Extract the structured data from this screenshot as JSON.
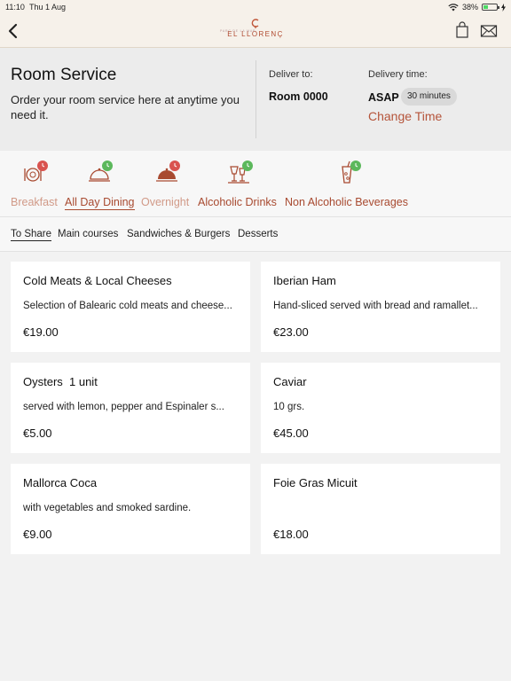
{
  "status_bar": {
    "time": "11:10",
    "date": "Thu 1 Aug",
    "battery": "38%",
    "battery_level": 0.38
  },
  "nav": {
    "logo_name": "EL LLORENÇ",
    "logo_sub": "PARC DE LA MAR",
    "icons": [
      "chevron-left-icon",
      "shopping-bag-icon",
      "envelope-icon"
    ]
  },
  "header": {
    "title": "Room Service",
    "description": "Order your room service here at anytime you need it.",
    "deliver_label": "Deliver to:",
    "room": "Room 0000",
    "delivery_time_label": "Delivery time:",
    "asap": "ASAP",
    "minutes": "30 minutes",
    "change_time": "Change Time"
  },
  "categories": [
    {
      "label": "Breakfast",
      "status": "closed",
      "state": "dim"
    },
    {
      "label": "All Day Dining",
      "status": "open",
      "state": "active"
    },
    {
      "label": "Overnight",
      "status": "closed",
      "state": "dim"
    },
    {
      "label": "Alcoholic Drinks",
      "status": "open",
      "state": "normal"
    },
    {
      "label": "Non Alcoholic Beverages",
      "status": "open",
      "state": "normal"
    }
  ],
  "status_colors": {
    "open": "#5cb85c",
    "closed": "#d9534f",
    "accent": "#a84a30"
  },
  "subcategories": [
    {
      "label": "To Share",
      "active": true
    },
    {
      "label": "Main courses",
      "active": false
    },
    {
      "label": "Sandwiches & Burgers",
      "active": false
    },
    {
      "label": "Desserts",
      "active": false
    }
  ],
  "items": [
    {
      "name": "Cold Meats & Local Cheeses",
      "desc": "Selection of Balearic cold meats and cheese...",
      "price": "€19.00"
    },
    {
      "name": "Iberian Ham",
      "desc": "Hand-sliced served with bread and ramallet...",
      "price": "€23.00"
    },
    {
      "name": "Oysters  1 unit",
      "desc": "served with lemon, pepper and Espinaler s...",
      "price": "€5.00"
    },
    {
      "name": "Caviar",
      "desc": "10 grs.",
      "price": "€45.00"
    },
    {
      "name": "Mallorca Coca",
      "desc": "with vegetables and smoked sardine.",
      "price": "€9.00"
    },
    {
      "name": "Foie Gras Micuit",
      "desc": "",
      "price": "€18.00"
    }
  ]
}
